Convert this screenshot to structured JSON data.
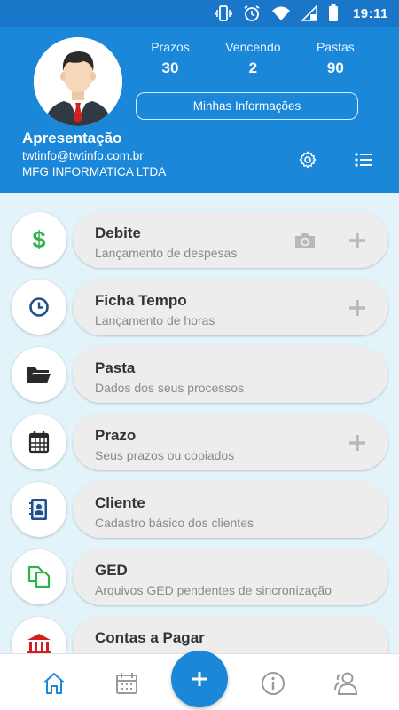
{
  "status_bar": {
    "time": "19:11",
    "icons": [
      "vibrate-icon",
      "alarm-icon",
      "wifi-icon",
      "signal-icon",
      "battery-icon"
    ]
  },
  "header": {
    "stats": [
      {
        "label": "Prazos",
        "value": "30"
      },
      {
        "label": "Vencendo",
        "value": "2"
      },
      {
        "label": "Pastas",
        "value": "90"
      }
    ],
    "info_button": "Minhas Informações",
    "profile": {
      "name": "Apresentação",
      "email": "twtinfo@twtinfo.com.br",
      "company": "MFG INFORMATICA LTDA"
    }
  },
  "menu": {
    "items": [
      {
        "title": "Debite",
        "subtitle": "Lançamento de despesas",
        "icon": "dollar-icon",
        "actions": [
          "camera-icon",
          "plus-icon"
        ]
      },
      {
        "title": "Ficha Tempo",
        "subtitle": "Lançamento de horas",
        "icon": "clock-icon",
        "actions": [
          "plus-icon"
        ]
      },
      {
        "title": "Pasta",
        "subtitle": "Dados dos seus processos",
        "icon": "folder-icon",
        "actions": []
      },
      {
        "title": "Prazo",
        "subtitle": "Seus prazos ou copiados",
        "icon": "calendar-icon",
        "actions": [
          "plus-icon"
        ]
      },
      {
        "title": "Cliente",
        "subtitle": "Cadastro básico dos clientes",
        "icon": "contact-book-icon",
        "actions": []
      },
      {
        "title": "GED",
        "subtitle": "Arquivos GED pendentes de sincronização",
        "icon": "documents-icon",
        "actions": []
      },
      {
        "title": "Contas a Pagar",
        "subtitle": "",
        "icon": "bank-icon",
        "actions": []
      }
    ]
  },
  "bottom_nav": {
    "items": [
      "home-icon",
      "calendar-icon",
      "add-icon",
      "info-icon",
      "users-icon"
    ]
  },
  "colors": {
    "header_blue": "#1b87d9",
    "status_blue": "#1976c9",
    "background": "#e3f3fa",
    "card": "#ededee",
    "green": "#2fb34a",
    "navy": "#1f4f8f",
    "red": "#d11f1f"
  }
}
